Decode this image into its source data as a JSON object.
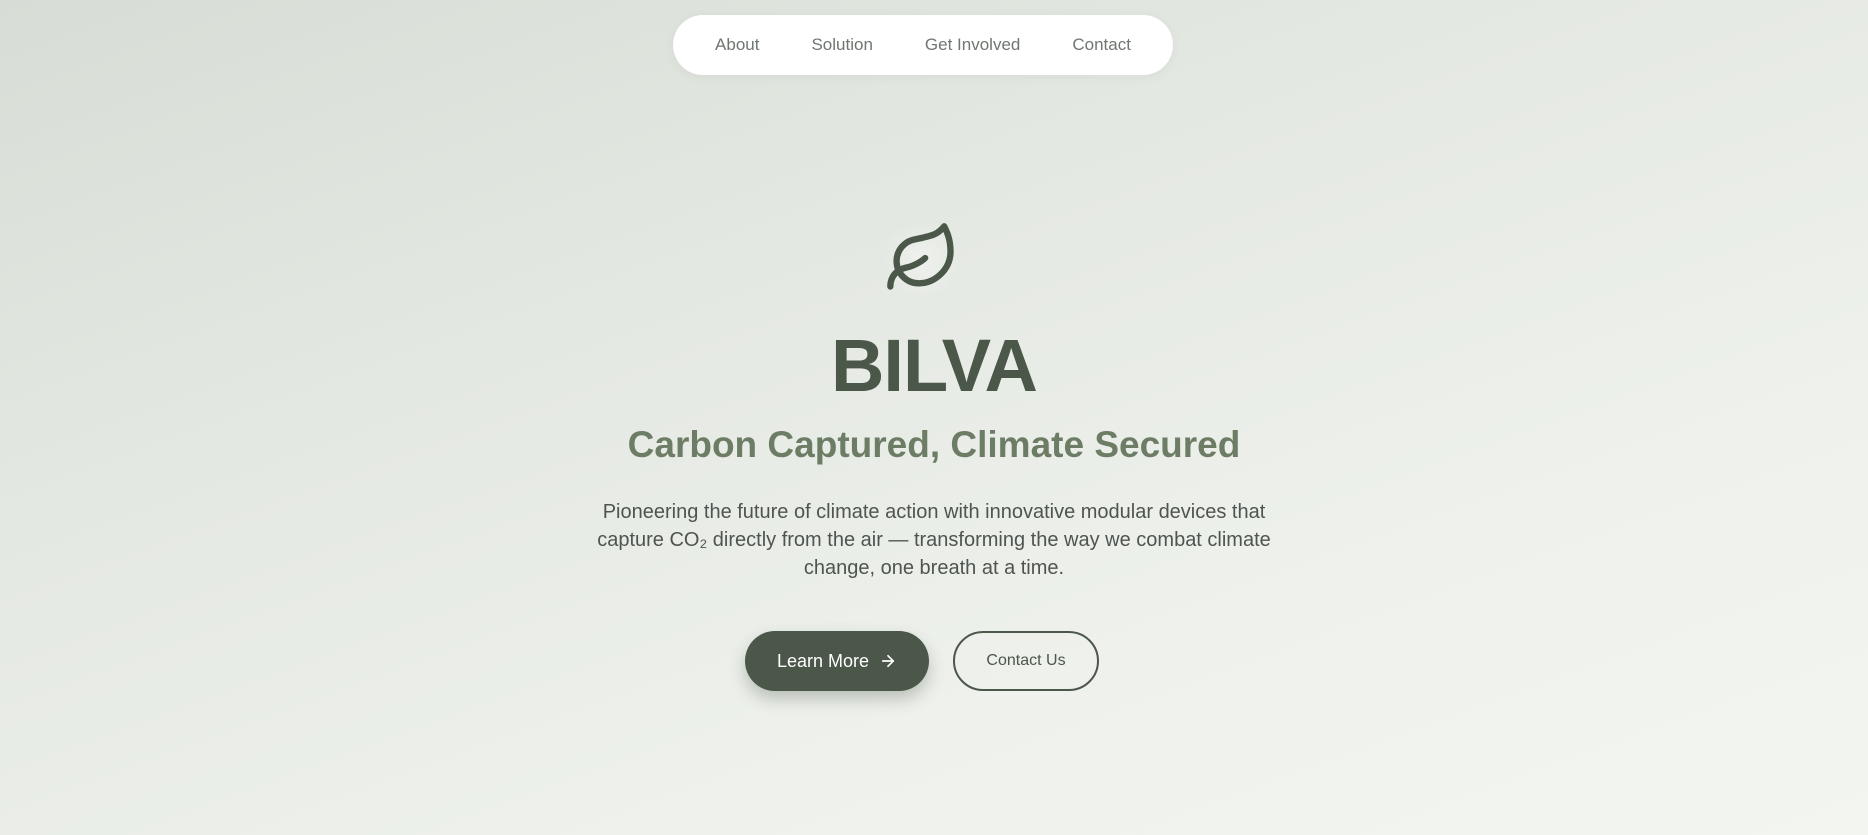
{
  "nav": {
    "items": [
      {
        "label": "About"
      },
      {
        "label": "Solution"
      },
      {
        "label": "Get Involved"
      },
      {
        "label": "Contact"
      }
    ]
  },
  "hero": {
    "icon": "leaf-icon",
    "title": "BILVA",
    "subtitle": "Carbon Captured, Climate Secured",
    "description_line1": "Pioneering the future of climate action with innovative modular devices that",
    "description_line2": "capture CO₂ directly from the air — transforming the way we combat climate",
    "description_line3": "change, one breath at a time.",
    "primary_button": {
      "label": "Learn More",
      "icon": "arrow-right-icon"
    },
    "secondary_button": {
      "label": "Contact Us"
    }
  },
  "colors": {
    "primary": "#4b5749",
    "accent": "#6d7d65",
    "text": "#4e5550",
    "nav_text": "#6f7670",
    "background": "#e4e8e2"
  }
}
